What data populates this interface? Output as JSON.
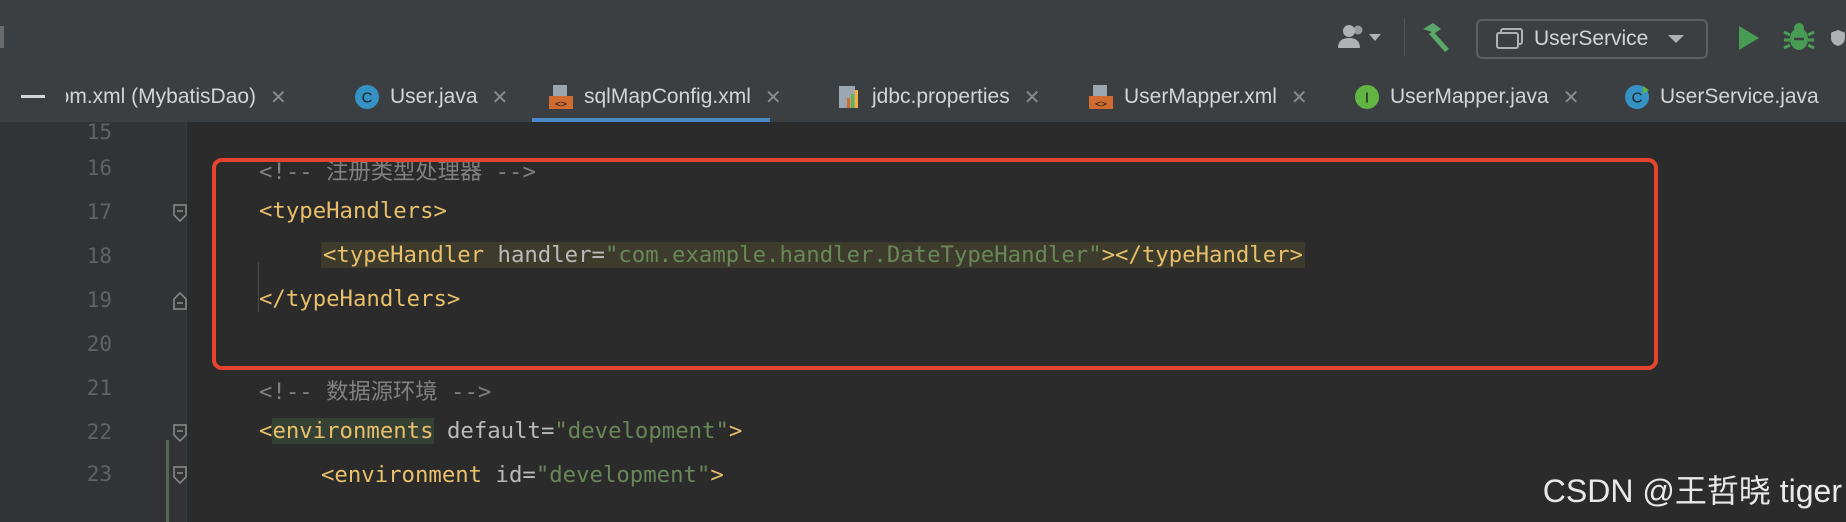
{
  "toolbar": {
    "run_config": "UserService"
  },
  "tabs": [
    {
      "label": "pom.xml (MybatisDao)",
      "icon": "maven-icon",
      "active": false
    },
    {
      "label": "User.java",
      "icon": "class-icon",
      "active": false
    },
    {
      "label": "sqlMapConfig.xml",
      "icon": "xml-icon",
      "active": true
    },
    {
      "label": "jdbc.properties",
      "icon": "properties-icon",
      "active": false
    },
    {
      "label": "UserMapper.xml",
      "icon": "xml-icon",
      "active": false
    },
    {
      "label": "UserMapper.java",
      "icon": "interface-icon",
      "active": false
    },
    {
      "label": "UserService.java",
      "icon": "class-icon",
      "active": false
    }
  ],
  "editor": {
    "line_numbers": [
      "15",
      "16",
      "17",
      "18",
      "19",
      "20",
      "21",
      "22",
      "23"
    ],
    "lines": {
      "l16_comment": "<!-- 注册类型处理器 -->",
      "l17_open": "<typeHandlers>",
      "l18_open": "<typeHandler",
      "l18_attr": "handler",
      "l18_eq": "=",
      "l18_val": "\"com.example.handler.DateTypeHandler\"",
      "l18_close": "></typeHandler>",
      "l19_close": "</typeHandlers>",
      "l21_comment": "<!-- 数据源环境 -->",
      "l22_lt": "<",
      "l22_name": "environments",
      "l22_attr": "default",
      "l22_eq": "=",
      "l22_val": "\"development\"",
      "l22_gt": ">",
      "l23_open": "<environment",
      "l23_attr": "id",
      "l23_eq": "=",
      "l23_val": "\"development\"",
      "l23_gt": ">"
    }
  },
  "watermark": "CSDN @王哲晓 tiger",
  "colors": {
    "tag": "#e8bf6a",
    "attribute": "#bababa",
    "value": "#6a8759",
    "comment": "#808080",
    "highlight_box": "#e8432e",
    "active_tab_underline": "#4a88c7"
  }
}
